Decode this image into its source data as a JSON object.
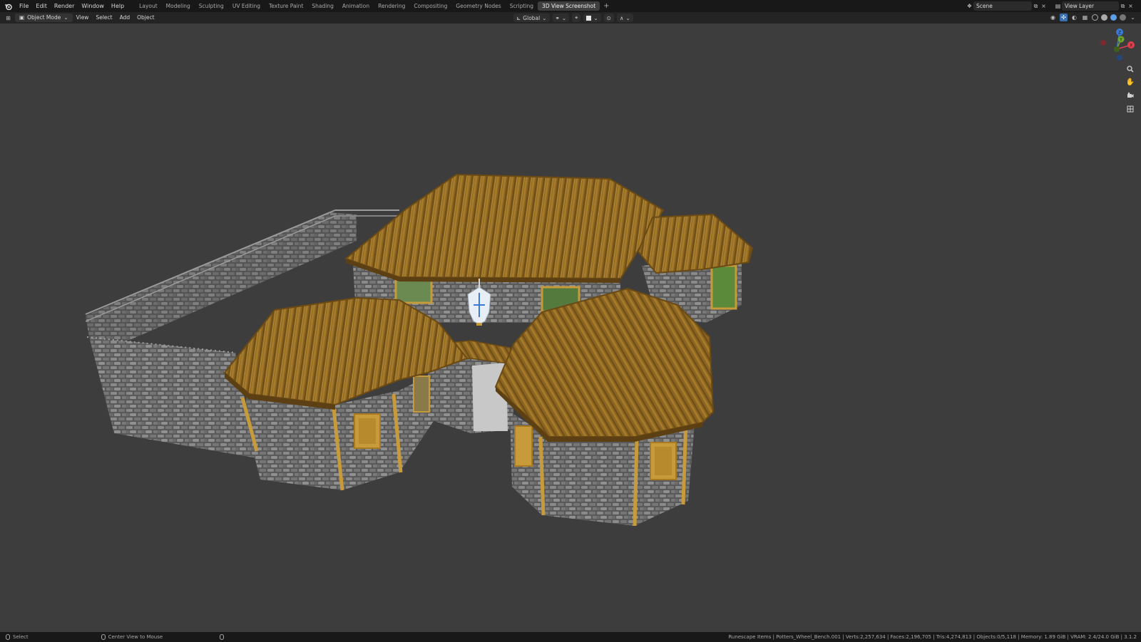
{
  "menu": {
    "items": [
      "File",
      "Edit",
      "Render",
      "Window",
      "Help"
    ]
  },
  "workspaces": {
    "tabs": [
      "Layout",
      "Modeling",
      "Sculpting",
      "UV Editing",
      "Texture Paint",
      "Shading",
      "Animation",
      "Rendering",
      "Compositing",
      "Geometry Nodes",
      "Scripting",
      "3D View Screenshot"
    ],
    "active": "3D View Screenshot",
    "add_label": "+"
  },
  "scene": {
    "name": "Scene"
  },
  "view_layer": {
    "name": "View Layer"
  },
  "header": {
    "mode": "Object Mode",
    "menus": [
      "View",
      "Select",
      "Add",
      "Object"
    ],
    "transform_orientation": "Global"
  },
  "gizmo": {
    "x_label": "X",
    "y_label": "Y",
    "z_label": "Z"
  },
  "status": {
    "left_action": "Select",
    "middle_action": "Center View to Mouse",
    "stats": "Runescape Items | Potters_Wheel_Bench.001 | Verts:2,257,634 | Faces:2,196,705 | Tris:4,274,813 | Objects:0/5,118 | Memory: 1.89 GiB | VRAM: 2.4/24.0 GiB | 3.1.2"
  },
  "colors": {
    "viewport_bg": "#3d3d3d",
    "topbar_bg": "#181818",
    "active_tab_bg": "#3f3f3f",
    "accent_blue": "#5c9ee8",
    "axis_x": "#e0404e",
    "axis_y": "#6ea82c",
    "axis_z": "#3a7ad6"
  },
  "icons": {
    "logo": "blender-logo-icon",
    "zoom": "zoom-icon",
    "pan": "hand-icon",
    "camera": "camera-icon",
    "grid": "grid-icon"
  }
}
